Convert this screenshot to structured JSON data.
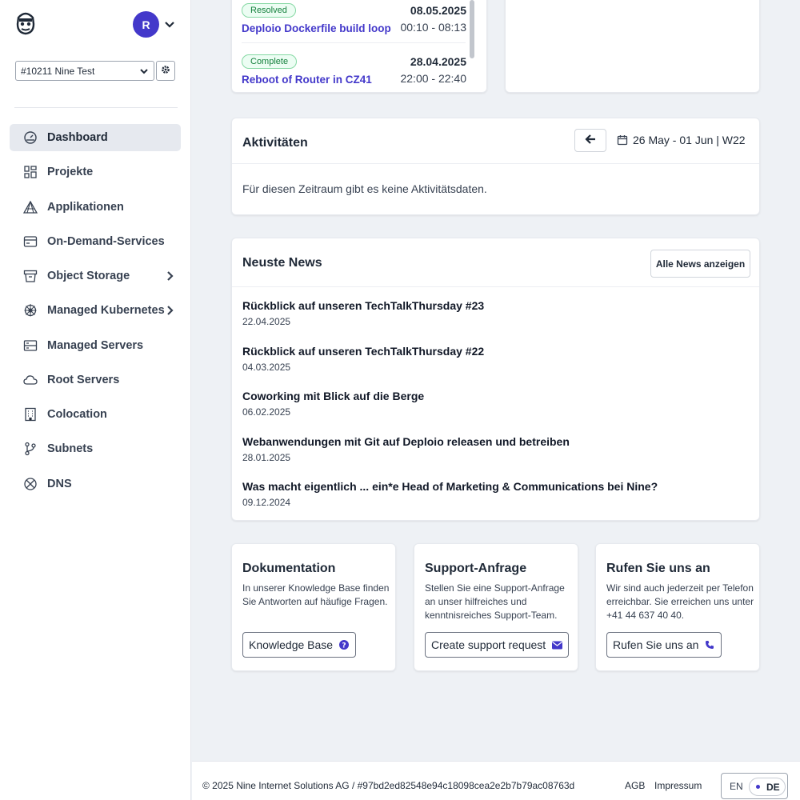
{
  "user": {
    "avatar_initial": "R"
  },
  "org": {
    "selected": "#10211 Nine Test"
  },
  "nav": {
    "items": [
      {
        "label": "Dashboard",
        "icon": "dashboard-icon"
      },
      {
        "label": "Projekte",
        "icon": "grid-icon"
      },
      {
        "label": "Applikationen",
        "icon": "deploio-icon"
      },
      {
        "label": "On-Demand-Services",
        "icon": "window-icon"
      },
      {
        "label": "Object Storage",
        "icon": "bucket-icon"
      },
      {
        "label": "Managed Kubernetes",
        "icon": "kubernetes-icon"
      },
      {
        "label": "Managed Servers",
        "icon": "server-icon"
      },
      {
        "label": "Root Servers",
        "icon": "cloud-icon"
      },
      {
        "label": "Colocation",
        "icon": "building-icon"
      },
      {
        "label": "Subnets",
        "icon": "branch-icon"
      },
      {
        "label": "DNS",
        "icon": "globe-icon"
      }
    ]
  },
  "maintenance": {
    "items": [
      {
        "status": "Resolved",
        "title": "Deploio Dockerfile build loop",
        "date": "08.05.2025",
        "time": "00:10 - 08:13"
      },
      {
        "status": "Complete",
        "title": "Reboot of Router in CZ41",
        "date": "28.04.2025",
        "time": "22:00 - 22:40"
      }
    ]
  },
  "activities": {
    "title": "Aktivitäten",
    "range": "26 May - 01 Jun | W22",
    "empty": "Für diesen Zeitraum gibt es keine Aktivitätsdaten."
  },
  "news": {
    "title": "Neuste News",
    "all_button": "Alle News anzeigen",
    "items": [
      {
        "title": "Rückblick auf unseren TechTalkThursday #23",
        "date": "22.04.2025"
      },
      {
        "title": "Rückblick auf unseren TechTalkThursday #22",
        "date": "04.03.2025"
      },
      {
        "title": "Coworking mit Blick auf die Berge",
        "date": "06.02.2025"
      },
      {
        "title": "Webanwendungen mit Git auf Deploio releasen und betreiben",
        "date": "28.01.2025"
      },
      {
        "title": "Was macht eigentlich ... ein*e Head of Marketing & Communications bei Nine?",
        "date": "09.12.2024"
      }
    ]
  },
  "help": [
    {
      "title": "Dokumentation",
      "text": "In unserer Knowledge Base finden Sie Antworten auf häufige Fragen.",
      "button": "Knowledge Base",
      "icon": "question-circle-icon"
    },
    {
      "title": "Support-Anfrage",
      "text": "Stellen Sie eine Support-Anfrage an unser hilfreiches und kenntnisreiches Support-Team.",
      "button": "Create support request",
      "icon": "envelope-icon"
    },
    {
      "title": "Rufen Sie uns an",
      "text": "Wir sind auch jederzeit per Telefon erreichbar. Sie erreichen uns unter +41 44 637 40 40.",
      "button": "Rufen Sie uns an",
      "icon": "phone-icon"
    }
  ],
  "footer": {
    "copyright": "© 2025 Nine Internet Solutions AG / #97bd2ed82548e94c18098cea2e2b7b79ac08763d",
    "agb": "AGB",
    "impressum": "Impressum",
    "lang_en": "EN",
    "lang_de": "DE"
  },
  "colors": {
    "accent": "#4338ca",
    "status_green": "#15803d"
  }
}
